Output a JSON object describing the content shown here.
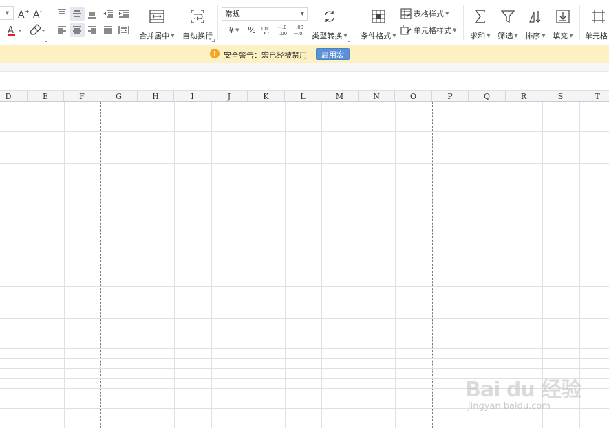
{
  "ribbon": {
    "merge_center_label": "合并居中",
    "auto_wrap_label": "自动换行",
    "number_format_value": "常规",
    "currency_symbol": "¥",
    "percent_symbol": "%",
    "thousands_symbol": "000",
    "increase_decimal_text": "←0\n.00",
    "type_convert_label": "类型转换",
    "conditional_format_label": "条件格式",
    "table_style_label": "表格样式",
    "cell_style_label": "单元格样式",
    "sum_label": "求和",
    "filter_label": "筛选",
    "sort_label": "排序",
    "fill_label": "填充",
    "cell_label": "单元格"
  },
  "security_bar": {
    "icon": "!",
    "message": "安全警告：宏已经被禁用",
    "enable_button": "启用宏"
  },
  "columns": [
    "D",
    "E",
    "F",
    "G",
    "H",
    "I",
    "J",
    "K",
    "L",
    "M",
    "N",
    "O",
    "P",
    "Q",
    "R",
    "S",
    "T"
  ],
  "watermark": {
    "logo": "Bai du 经验",
    "url": "jingyan.baidu.com"
  }
}
